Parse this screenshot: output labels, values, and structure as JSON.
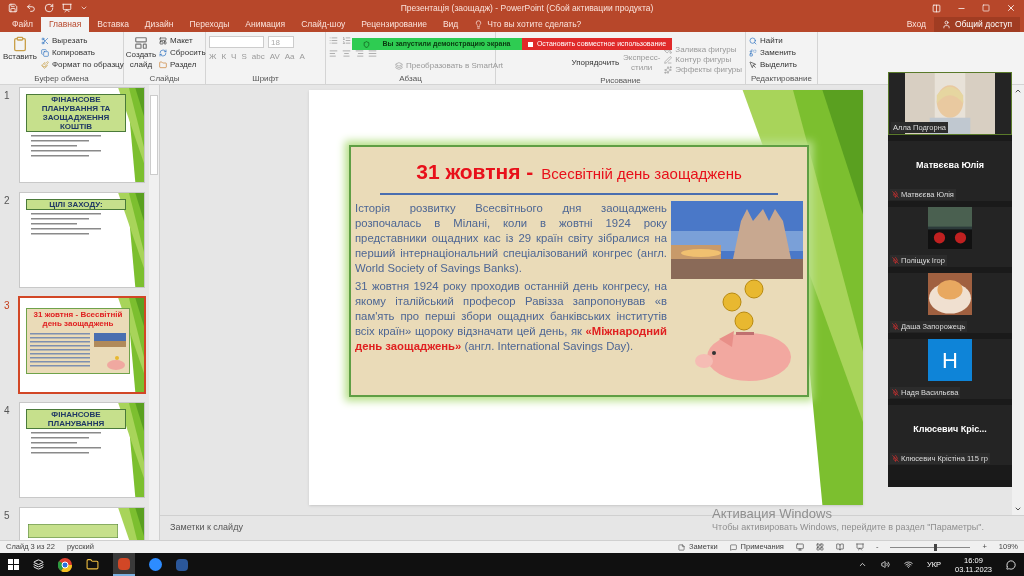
{
  "window": {
    "title": "Презентація (заощадж) - PowerPoint (Сбой активации продукта)"
  },
  "tabs": [
    {
      "label": "Файл",
      "selected": false
    },
    {
      "label": "Главная",
      "selected": true
    },
    {
      "label": "Вставка",
      "selected": false
    },
    {
      "label": "Дизайн",
      "selected": false
    },
    {
      "label": "Переходы",
      "selected": false
    },
    {
      "label": "Анимация",
      "selected": false
    },
    {
      "label": "Слайд-шоу",
      "selected": false
    },
    {
      "label": "Рецензирование",
      "selected": false
    },
    {
      "label": "Вид",
      "selected": false
    }
  ],
  "tell_me": "Что вы хотите сделать?",
  "account": {
    "sign_in": "Вход",
    "share": "Общий доступ"
  },
  "ribbon": {
    "clipboard": {
      "paste": "Вставить",
      "cut": "Вырезать",
      "copy": "Копировать",
      "format_painter": "Формат по образцу",
      "label": "Буфер обмена"
    },
    "slides": {
      "new_slide": "Создать слайд",
      "layout": "Макет",
      "reset": "Сбросить",
      "section": "Раздел",
      "label": "Слайды"
    },
    "font": {
      "size": "18",
      "buttons": [
        "Ж",
        "К",
        "Ч",
        "S",
        "abc",
        "AV",
        "Aa",
        "A"
      ],
      "label": "Шрифт"
    },
    "paragraph": {
      "smartart": "Преобразовать в SmartArt",
      "label": "Абзац"
    },
    "drawing": {
      "arrange": "Упорядочить",
      "quick_styles": "Экспресс-стили",
      "fill": "Заливка фигуры",
      "outline": "Контур фигуры",
      "effects": "Эффекты фигуры",
      "label": "Рисование"
    },
    "editing": {
      "find": "Найти",
      "replace": "Заменить",
      "select": "Выделить",
      "label": "Редактирование"
    }
  },
  "share_banner": {
    "status": "Вы запустили демонстрацию экрана",
    "stop": "Остановить совместное использование"
  },
  "thumbnails": [
    {
      "number": "1",
      "selected": false,
      "title": "ФІНАНСОВЕ ПЛАНУВАННЯ ТА ЗАОЩАДЖЕННЯ КОШТІВ"
    },
    {
      "number": "2",
      "selected": false,
      "title": "ЦІЛІ ЗАХОДУ:"
    },
    {
      "number": "3",
      "selected": true,
      "title": "31 жовтня - Всесвітній день заощаджень"
    },
    {
      "number": "4",
      "selected": false,
      "title": "ФІНАНСОВЕ ПЛАНУВАННЯ"
    },
    {
      "number": "5",
      "selected": false
    }
  ],
  "slide": {
    "title_lead": "31 жовтня -",
    "title_rest": "Всесвітній день заощаджень",
    "paragraphs": [
      "Історія розвитку Всесвітнього дня заощаджень розпочалась в Мілані, коли в жовтні 1924 року представники ощадних кас із 29 країн світу зібралися на перший інтернаціональний спеціалізований конгрес (англ. World Society of Savings Banks).",
      "31 жовтня 1924 року проходив останній день конгресу, на якому італійський професор Равізза запропонував «в пам'ять про перші збори ощадних банківських інститутів всіх країн» щороку відзначати цей день, як **«Міжнародний день заощаджень»** (англ. International Savings Day)."
    ]
  },
  "notes_placeholder": "Заметки к слайду",
  "activation": {
    "title": "Активация Windows",
    "hint": "Чтобы активировать Windows, перейдите в раздел \"Параметры\"."
  },
  "participants": [
    {
      "kind": "video",
      "label": "Алла Подгорна",
      "muted": false,
      "active": true
    },
    {
      "kind": "name",
      "display": "Матвєєва Юлія",
      "label": "Матвєєва Юлія",
      "muted": true,
      "active": false
    },
    {
      "kind": "video",
      "label": "Поліщук Ігор",
      "muted": true,
      "active": false
    },
    {
      "kind": "video",
      "label": "Даша Запорожець",
      "muted": true,
      "active": false
    },
    {
      "kind": "avatar",
      "display": "Н",
      "label": "Надя Васильєва",
      "muted": true,
      "active": false
    },
    {
      "kind": "name",
      "display": "Клюсевич  Кріс...",
      "label": "Клюсевич Крістіна 115 гр",
      "muted": true,
      "active": false
    }
  ],
  "status_bar": {
    "slide": "Слайд 3 из 22",
    "language": "русский",
    "notes": "Заметки",
    "comments": "Примечания",
    "minus": "-",
    "plus": "+",
    "zoom": {
      "level": 0.55
    },
    "zoom_text": "109%"
  },
  "taskbar": {
    "language": "УКР",
    "time": "16:09",
    "date": "03.11.2023"
  }
}
